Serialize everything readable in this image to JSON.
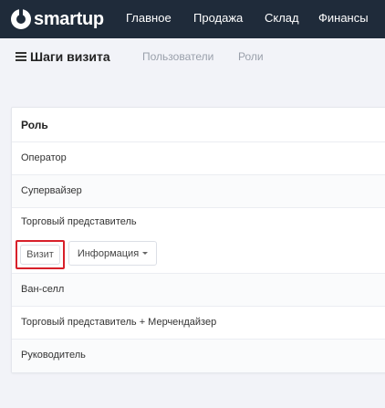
{
  "app": {
    "brand": "smartup"
  },
  "nav": {
    "items": [
      "Главное",
      "Продажа",
      "Склад",
      "Финансы"
    ]
  },
  "page": {
    "title": "Шаги визита",
    "tabs": [
      "Пользователи",
      "Роли"
    ]
  },
  "table": {
    "header": "Роль",
    "rows": [
      "Оператор",
      "Супервайзер",
      "Торговый представитель",
      "Ван-селл",
      "Торговый представитель + Мерчендайзер",
      "Руководитель"
    ],
    "actions": {
      "visit_label": "Визит",
      "info_label": "Информация"
    }
  },
  "colors": {
    "topbar": "#1f2b3a",
    "highlight": "#d8202a"
  }
}
